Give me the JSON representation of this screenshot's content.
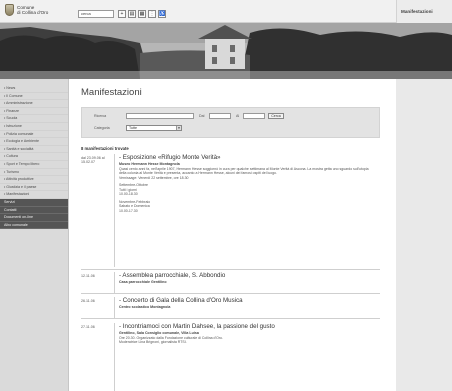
{
  "header": {
    "municipality_line1": "Comune",
    "municipality_line2": "di Collina d'Oro",
    "search_value": "cerca",
    "tool_icons": [
      "zoom-in-icon",
      "print-icon",
      "image-icon",
      "sitemap-icon",
      "accessibility-icon"
    ],
    "section_label": "Manifestazioni"
  },
  "sidebar": {
    "items": [
      {
        "label": "• News"
      },
      {
        "label": "• Il Comune"
      },
      {
        "label": "• Amministrazione"
      },
      {
        "label": "• Finanze"
      },
      {
        "label": "• Scuola"
      },
      {
        "label": "• Istruzione"
      },
      {
        "label": "• Polizia comunale"
      },
      {
        "label": "• Ecologia e Ambiente"
      },
      {
        "label": "• Sanità e socialità"
      },
      {
        "label": "• Cultura"
      },
      {
        "label": "• Sport e Tempo libero"
      },
      {
        "label": "• Turismo"
      },
      {
        "label": "• Attività produttive"
      },
      {
        "label": "• Giustizia e il paese"
      },
      {
        "label": "• Manifestazioni"
      },
      {
        "label": "Servizi",
        "dark": true
      },
      {
        "label": "Contatti",
        "dark": true
      },
      {
        "label": "Documenti on-line",
        "dark": true
      },
      {
        "label": "Albo comunale",
        "dark": true
      }
    ]
  },
  "main": {
    "title": "Manifestazioni",
    "filter": {
      "search_label": "Ricerca",
      "from_label": "Dal",
      "to_label": "Al",
      "button_label": "Cerca",
      "category_label": "Categoria",
      "category_value": "Tutte"
    },
    "count_text": "8 manifestazioni trovate",
    "events": [
      {
        "date": "dal 23.09.06 al 15.02.07",
        "title": "- Esposizione «Rifugio Monte Verità»",
        "subtitle": "Museo Hermann Hesse Montagnola",
        "text": "Quasi cento anni fa, nell'aprile 1907, Hermann Hesse soggiornò in cura per qualche settimana al Monte Verità di Ascona. La mostra getta uno sguardo sull'utopia della colonia al Monte Verità e presenta, accanto a Hermann Hesse, alcuni dei famosi ospiti del luogo.",
        "text2": "Vernissage: Venerdì 22 settembre, ore 18.30",
        "text3": "Settembre-Ottobre",
        "text4": "Tutti i giorni",
        "text5": "10.00-18.30",
        "text6": "Novembre-Febbraio",
        "text7": "Sabato e Domenica",
        "text8": "10.00-17.30"
      },
      {
        "date": "12.11.06",
        "title": "- Assemblea parrocchiale, S. Abbondio",
        "subtitle": "Casa parrocchiale Gentilino"
      },
      {
        "date": "26.11.06",
        "title": "- Concerto di Gala della Collina d'Oro Musica",
        "subtitle": "Centro scolastico Montagnola"
      },
      {
        "date": "27.11.06",
        "title": "- Incontriamoci con Martin Dahsee, la passione del gusto",
        "subtitle": "Gentilino, Sala Consiglio comunale, Villa Luisa",
        "text": "Ore 20.30. Organizzato dalla Fondazione culturale di Collina d'Oro.",
        "text2": "Moderatrice Lina Brignoni, giornalista RTSI."
      }
    ]
  }
}
